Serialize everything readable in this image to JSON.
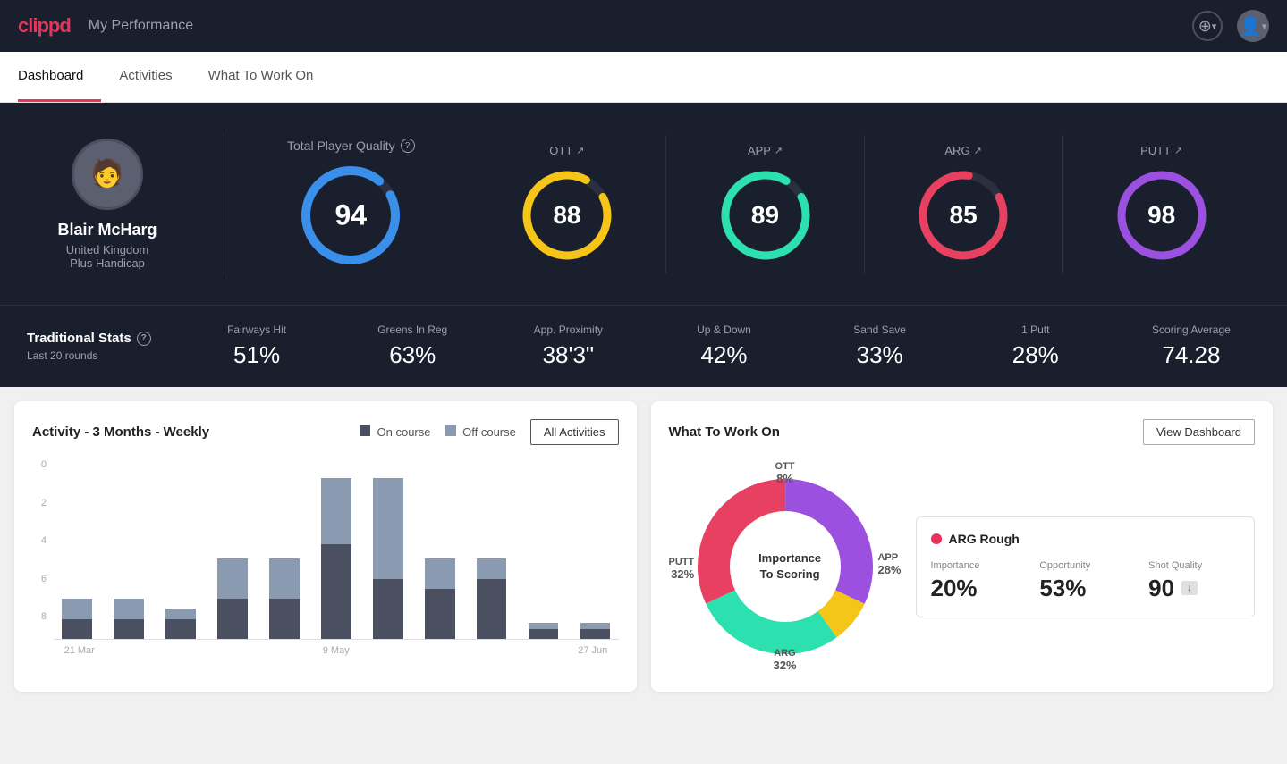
{
  "header": {
    "logo": "clippd",
    "title": "My Performance",
    "add_icon": "+",
    "chevron_down": "▾"
  },
  "tabs": [
    {
      "label": "Dashboard",
      "active": true
    },
    {
      "label": "Activities",
      "active": false
    },
    {
      "label": "What To Work On",
      "active": false
    }
  ],
  "player": {
    "name": "Blair McHarg",
    "country": "United Kingdom",
    "handicap": "Plus Handicap"
  },
  "total_player_quality": {
    "label": "Total Player Quality",
    "value": "94",
    "color": "#3a8fea"
  },
  "score_cards": [
    {
      "label": "OTT",
      "value": "88",
      "color": "#f5c518",
      "arrow": "↗"
    },
    {
      "label": "APP",
      "value": "89",
      "color": "#2de0b0",
      "arrow": "↗"
    },
    {
      "label": "ARG",
      "value": "85",
      "color": "#e84060",
      "arrow": "↗"
    },
    {
      "label": "PUTT",
      "value": "98",
      "color": "#9b50e0",
      "arrow": "↗"
    }
  ],
  "traditional_stats": {
    "title": "Traditional Stats",
    "subtitle": "Last 20 rounds",
    "stats": [
      {
        "label": "Fairways Hit",
        "value": "51%"
      },
      {
        "label": "Greens In Reg",
        "value": "63%"
      },
      {
        "label": "App. Proximity",
        "value": "38'3\""
      },
      {
        "label": "Up & Down",
        "value": "42%"
      },
      {
        "label": "Sand Save",
        "value": "33%"
      },
      {
        "label": "1 Putt",
        "value": "28%"
      },
      {
        "label": "Scoring Average",
        "value": "74.28"
      }
    ]
  },
  "activity_chart": {
    "title": "Activity - 3 Months - Weekly",
    "legend": [
      {
        "label": "On course",
        "color": "#4a5060"
      },
      {
        "label": "Off course",
        "color": "#8a9ab0"
      }
    ],
    "all_activities_label": "All Activities",
    "y_labels": [
      "0",
      "2",
      "4",
      "6",
      "8"
    ],
    "x_labels": [
      "21 Mar",
      "",
      "",
      "",
      "",
      "9 May",
      "",
      "",
      "",
      "",
      "27 Jun"
    ],
    "bars": [
      {
        "on": 1,
        "off": 1
      },
      {
        "on": 1,
        "off": 1
      },
      {
        "on": 1,
        "off": 0.5
      },
      {
        "on": 2,
        "off": 2
      },
      {
        "on": 2,
        "off": 2
      },
      {
        "on": 5,
        "off": 3.5
      },
      {
        "on": 3,
        "off": 5
      },
      {
        "on": 2.5,
        "off": 1.5
      },
      {
        "on": 3,
        "off": 1
      },
      {
        "on": 0.5,
        "off": 0.3
      },
      {
        "on": 0.5,
        "off": 0.3
      }
    ]
  },
  "what_to_work_on": {
    "title": "What To Work On",
    "view_dashboard_label": "View Dashboard",
    "donut_center": "Importance\nTo Scoring",
    "segments": [
      {
        "label": "OTT",
        "value": "8%",
        "color": "#f5c518"
      },
      {
        "label": "APP",
        "value": "28%",
        "color": "#2de0b0"
      },
      {
        "label": "ARG",
        "value": "32%",
        "color": "#e84060"
      },
      {
        "label": "PUTT",
        "value": "32%",
        "color": "#9b50e0"
      }
    ],
    "arg_card": {
      "title": "ARG Rough",
      "dot_color": "#e84060",
      "metrics": [
        {
          "label": "Importance",
          "value": "20%"
        },
        {
          "label": "Opportunity",
          "value": "53%"
        },
        {
          "label": "Shot Quality",
          "value": "90",
          "badge": "↓"
        }
      ]
    }
  }
}
